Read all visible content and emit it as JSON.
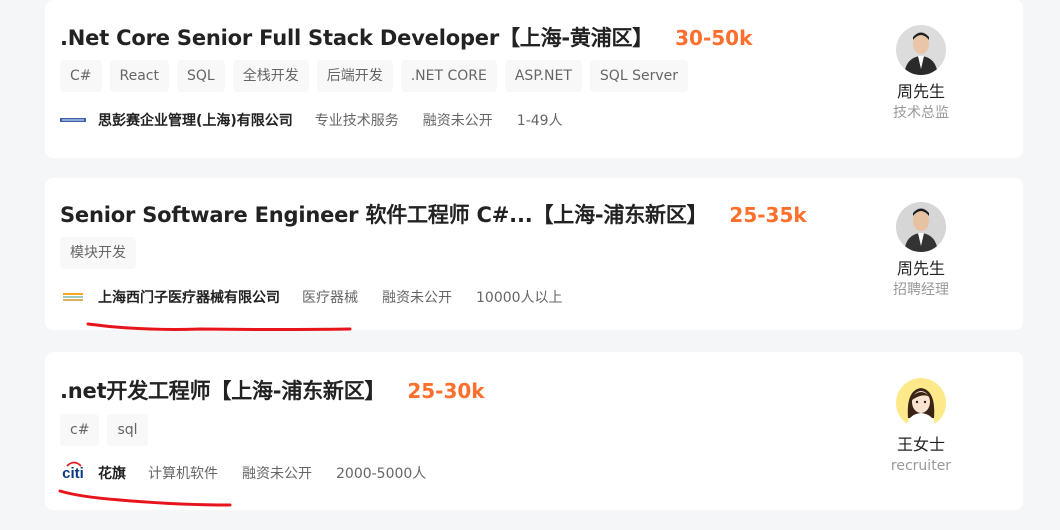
{
  "jobs": [
    {
      "title": ".Net Core Senior Full Stack Developer【上海-黄浦区】",
      "salary": "30-50k",
      "tags": [
        "C#",
        "React",
        "SQL",
        "全栈开发",
        "后端开发",
        ".NET CORE",
        "ASP.NET",
        "SQL Server"
      ],
      "company": "思彭赛企业管理(上海)有限公司",
      "industry": "专业技术服务",
      "funding": "融资未公开",
      "size": "1-49人",
      "recruiter": {
        "name": "周先生",
        "role": "技术总监"
      }
    },
    {
      "title": "Senior Software Engineer 软件工程师 C#...【上海-浦东新区】",
      "salary": "25-35k",
      "tags": [
        "模块开发"
      ],
      "company": "上海西门子医疗器械有限公司",
      "industry": "医疗器械",
      "funding": "融资未公开",
      "size": "10000人以上",
      "recruiter": {
        "name": "周先生",
        "role": "招聘经理"
      }
    },
    {
      "title": ".net开发工程师【上海-浦东新区】",
      "salary": "25-30k",
      "tags": [
        "c#",
        "sql"
      ],
      "company": "花旗",
      "company_logo_text": "citi",
      "industry": "计算机软件",
      "funding": "融资未公开",
      "size": "2000-5000人",
      "recruiter": {
        "name": "王女士",
        "role": "recruiter"
      }
    }
  ],
  "colors": {
    "salary": "#fe6f2d",
    "underline": "#e8141b"
  }
}
